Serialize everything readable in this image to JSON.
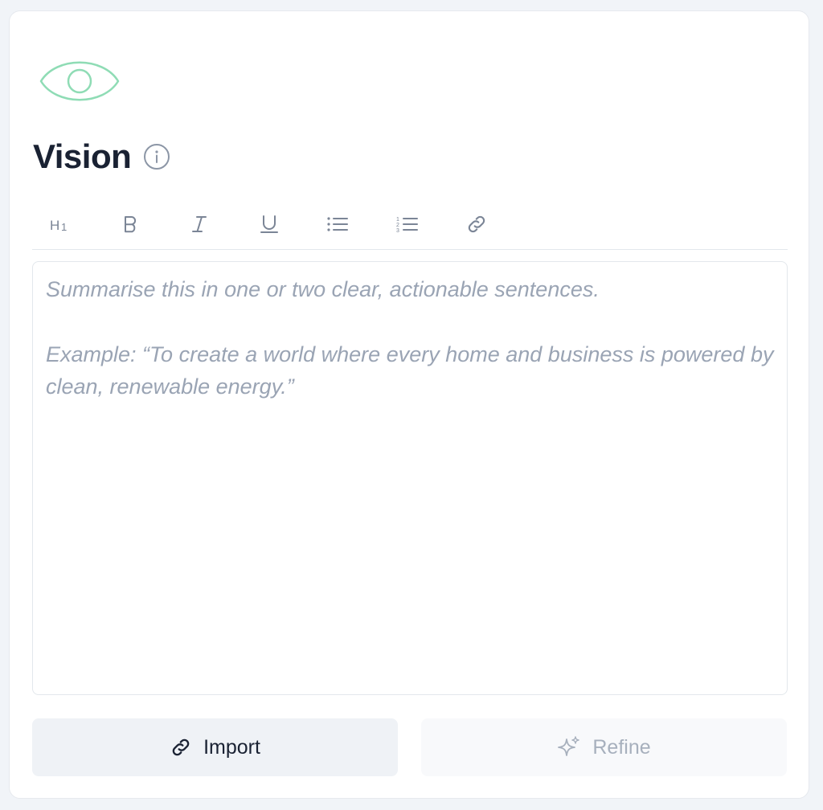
{
  "section": {
    "title": "Vision",
    "header_icon": "eye-icon",
    "info_icon": "info-icon",
    "accent_color": "#8fdcb5"
  },
  "toolbar": {
    "items": [
      {
        "name": "heading-1",
        "icon": "h1-icon"
      },
      {
        "name": "bold",
        "icon": "bold-icon"
      },
      {
        "name": "italic",
        "icon": "italic-icon"
      },
      {
        "name": "underline",
        "icon": "underline-icon"
      },
      {
        "name": "bullet-list",
        "icon": "bullet-list-icon"
      },
      {
        "name": "numbered-list",
        "icon": "numbered-list-icon"
      },
      {
        "name": "link",
        "icon": "link-icon"
      }
    ]
  },
  "editor": {
    "placeholder_line1": "Summarise this in one or two clear, actionable sentences.",
    "placeholder_line2": "Example: “To create a world where every home and business is powered by clean, renewable energy.”"
  },
  "actions": {
    "import_label": "Import",
    "import_icon": "link-icon",
    "refine_label": "Refine",
    "refine_icon": "sparkle-icon"
  }
}
